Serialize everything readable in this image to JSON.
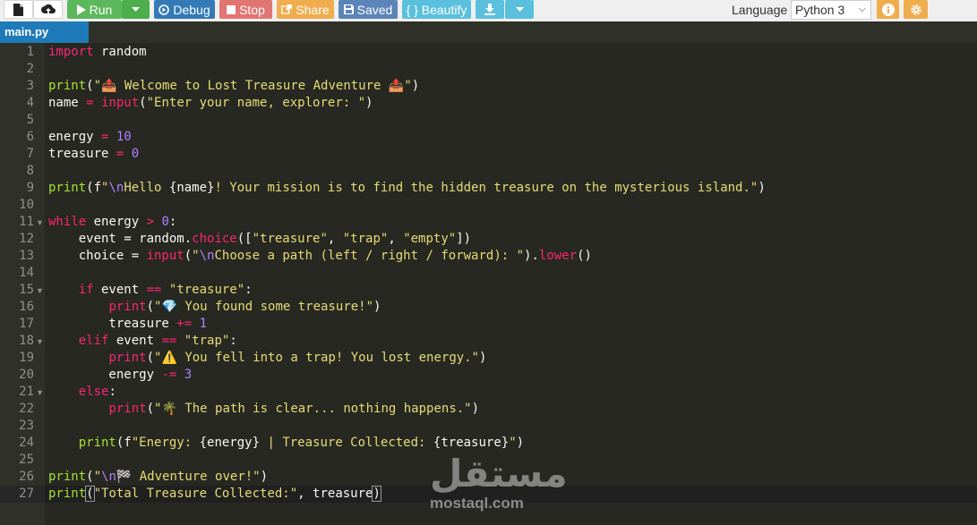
{
  "toolbar": {
    "run_label": "Run",
    "debug_label": "Debug",
    "stop_label": "Stop",
    "share_label": "Share",
    "saved_label": "Saved",
    "beautify_label": "{ } Beautify",
    "language_label": "Language",
    "language_value": "Python 3"
  },
  "tab": {
    "file_name": "main.py"
  },
  "editor": {
    "line_numbers": [
      "1",
      "2",
      "3",
      "4",
      "5",
      "6",
      "7",
      "8",
      "9",
      "10",
      "11",
      "12",
      "13",
      "14",
      "15",
      "16",
      "17",
      "18",
      "19",
      "20",
      "21",
      "22",
      "23",
      "24",
      "25",
      "26",
      "27"
    ],
    "active_line": 27
  },
  "code": {
    "l1": [
      "import",
      " random"
    ],
    "l3": [
      "print",
      "(",
      "\"📤 Welcome to Lost Treasure Adventure 📤\"",
      ")"
    ],
    "l4": [
      "name",
      " = ",
      "input",
      "(",
      "\"Enter your name, explorer: \"",
      ")"
    ],
    "l6": [
      "energy",
      " = ",
      "10"
    ],
    "l7": [
      "treasure",
      " = ",
      "0"
    ],
    "l9": [
      "print",
      "(f",
      "\"",
      "\\n",
      "Hello ",
      "{name}",
      "! Your mission is to find the hidden treasure on the mysterious island.\"",
      ")"
    ],
    "l11": [
      "while",
      " energy ",
      ">",
      " ",
      "0",
      ":"
    ],
    "l12": [
      "    event = random.",
      "choice",
      "([",
      "\"treasure\"",
      ", ",
      "\"trap\"",
      ", ",
      "\"empty\"",
      "])"
    ],
    "l13": [
      "    choice = ",
      "input",
      "(",
      "\"",
      "\\n",
      "Choose a path (left / right / forward): \"",
      ").",
      "lower",
      "()"
    ],
    "l15": [
      "    ",
      "if",
      " event ",
      "==",
      " ",
      "\"treasure\"",
      ":"
    ],
    "l16": [
      "        ",
      "print",
      "(",
      "\"💎 You found some treasure!\"",
      ")"
    ],
    "l17": [
      "        treasure ",
      "+=",
      " ",
      "1"
    ],
    "l18": [
      "    ",
      "elif",
      " event ",
      "==",
      " ",
      "\"trap\"",
      ":"
    ],
    "l19": [
      "        ",
      "print",
      "(",
      "\"⚠️ You fell into a trap! You lost energy.\"",
      ")"
    ],
    "l20": [
      "        energy ",
      "-=",
      " ",
      "3"
    ],
    "l21": [
      "    ",
      "else",
      ":"
    ],
    "l22": [
      "        ",
      "print",
      "(",
      "\"🌴 The path is clear... nothing happens.\"",
      ")"
    ],
    "l24": [
      "    ",
      "print",
      "(f",
      "\"Energy: ",
      "{energy}",
      " | Treasure Collected: ",
      "{treasure}",
      "\"",
      ")"
    ],
    "l26": [
      "print",
      "(",
      "\"",
      "\\n",
      "🏁 Adventure over!\"",
      ")"
    ],
    "l27": [
      "print",
      "(",
      "\"Total Treasure Collected:\"",
      ", treasure",
      ")"
    ]
  },
  "watermark": {
    "arabic_text": "مستقل",
    "latin_text": "mostaql.com"
  },
  "colors": {
    "editor_bg": "#272822",
    "keyword": "#f92672",
    "function": "#a6e22e",
    "string": "#e6db74",
    "number": "#ae81ff",
    "run_button": "#5cb85c",
    "debug_button": "#337ab7",
    "stop_button": "#e17571",
    "share_button": "#f0ad4e",
    "tab_active": "#1e7ab8"
  }
}
